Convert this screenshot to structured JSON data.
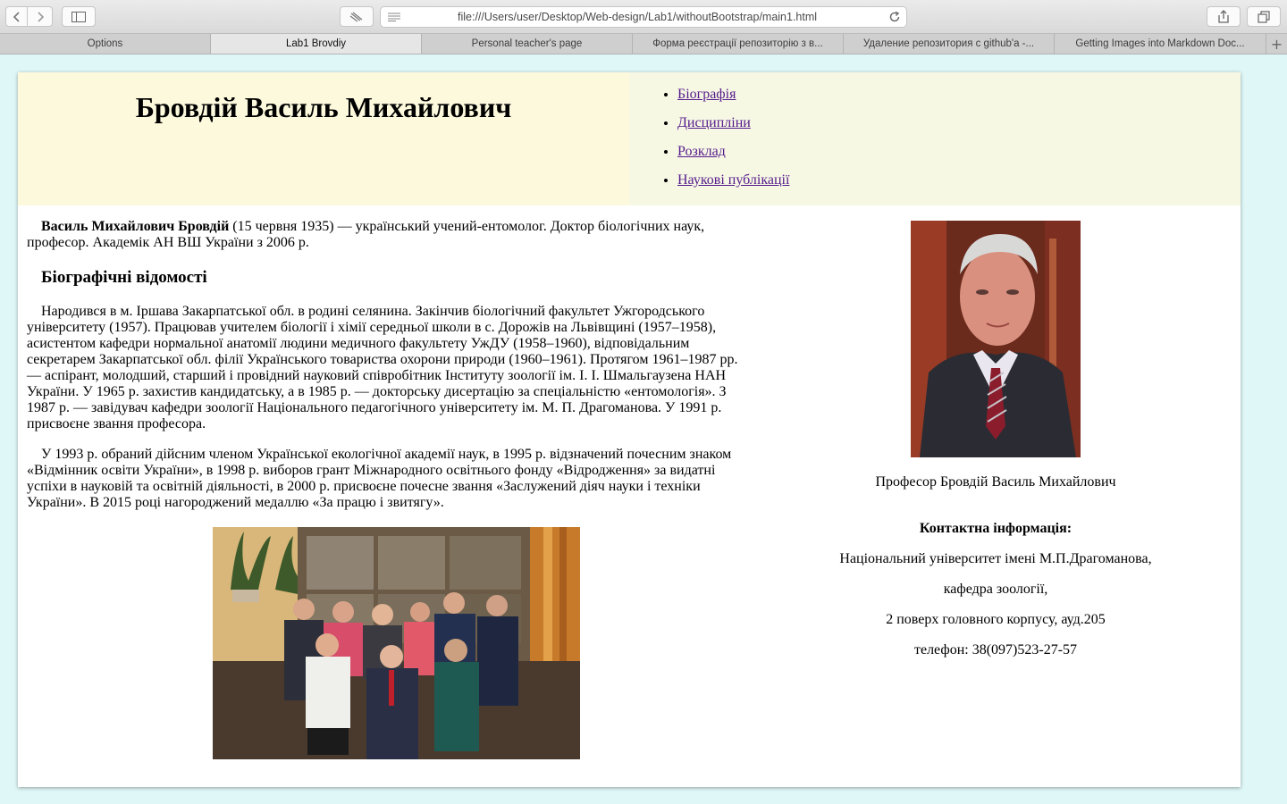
{
  "browser": {
    "url": "file:///Users/user/Desktop/Web-design/Lab1/withoutBootstrap/main1.html",
    "tabs": [
      {
        "label": "Options"
      },
      {
        "label": "Lab1 Brovdiy"
      },
      {
        "label": "Personal teacher's page"
      },
      {
        "label": "Форма реєстрації репозиторію з в..."
      },
      {
        "label": "Удаление репозитория с github'а -..."
      },
      {
        "label": "Getting Images into Markdown Doc..."
      }
    ]
  },
  "header": {
    "title": "Бровдій Василь Михайлович",
    "nav": [
      {
        "label": "Біографія"
      },
      {
        "label": "Дисципліни"
      },
      {
        "label": "Розклад"
      },
      {
        "label": "Наукові публікації"
      }
    ]
  },
  "main": {
    "intro_name": "Василь Михайлович Бровдій",
    "intro_rest": " (15 червня 1935) — український учений-ентомолог. Доктор біологічних наук, професор. Академік АН ВШ України з 2006 р.",
    "bio_heading": "Біографічні відомості",
    "bio_p1": "Народився в м. Іршава Закарпатської обл. в родині селянина. Закінчив біологічний факультет Ужгородського університету (1957). Працював учителем біології і хімії середньої школи в с. Дорожів на Львівщині (1957–1958), асистентом кафедри нормальної анатомії людини медичного факультету УжДУ (1958–1960), відповідальним секретарем Закарпатської обл. філії Українського товариства охорони природи (1960–1961). Протягом 1961–1987 рр. — аспірант, молодший, старший і провідний науковий співробітник Інституту зоології ім. І. І. Шмальгаузена НАН України. У 1965 р. захистив кандидатську, а в 1985 р. — докторську дисертацію за спеціальністю «ентомологія». З 1987 р. — завідувач кафедри зоології Національного педагогічного університету ім. М. П. Драгоманова. У 1991 р. присвоєне звання професора.",
    "bio_p2": "У 1993 р. обраний дійсним членом Української екологічної академії наук, в 1995 р. відзначений почесним знаком «Відмінник освіти України», в 1998 р. виборов грант Міжнародного освітнього фонду «Відродження» за видатні успіхи в науковій та освітній діяльності, в 2000 р. присвоєне почесне звання «Заслужений діяч науки і техніки України». В 2015 році нагороджений медаллю «За працю і звитягу»."
  },
  "sidebar": {
    "caption": "Професор Бровдій Василь Михайлович",
    "contact_heading": "Контактна інформація:",
    "contact_lines": [
      "Національний університет імені М.П.Драгоманова,",
      "кафедра зоології,",
      "2 поверх головного корпусу, ауд.205",
      "телефон: 38(097)523-27-57"
    ]
  }
}
